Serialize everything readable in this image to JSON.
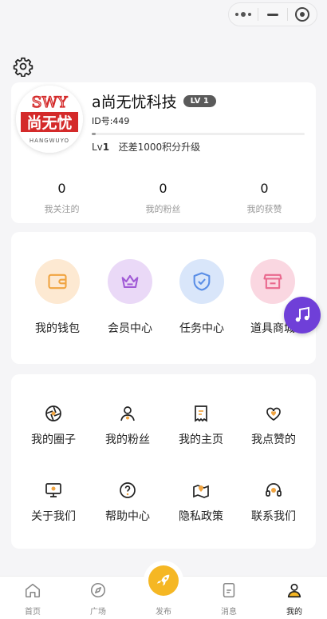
{
  "user": {
    "name": "a尚无忧科技",
    "level_badge": "LV 1",
    "id_text": "ID号:449",
    "level_prefix": "Lv",
    "level_num": "1",
    "level_hint": "还差1000积分升级",
    "progress": 0.02,
    "avatar_logo_text": "SWY",
    "avatar_main_text": "尚无忧",
    "avatar_sub_text": "HANGWUYO"
  },
  "stats": [
    {
      "value": "0",
      "label": "我关注的"
    },
    {
      "value": "0",
      "label": "我的粉丝"
    },
    {
      "value": "0",
      "label": "我的获赞"
    }
  ],
  "features": [
    {
      "label": "我的钱包",
      "icon": "wallet-icon",
      "bg": "#fde9d2",
      "color": "#f0a441"
    },
    {
      "label": "会员中心",
      "icon": "crown-icon",
      "bg": "#ead9f7",
      "color": "#a15bd6"
    },
    {
      "label": "任务中心",
      "icon": "shield-check-icon",
      "bg": "#d9e6fa",
      "color": "#5a8ee6"
    },
    {
      "label": "道具商城",
      "icon": "store-icon",
      "bg": "#fad7e1",
      "color": "#e9698e"
    }
  ],
  "menu": [
    {
      "label": "我的圈子",
      "icon": "aperture-icon"
    },
    {
      "label": "我的粉丝",
      "icon": "person-icon"
    },
    {
      "label": "我的主页",
      "icon": "receipt-icon"
    },
    {
      "label": "我点赞的",
      "icon": "heart-icon"
    },
    {
      "label": "关于我们",
      "icon": "monitor-icon"
    },
    {
      "label": "帮助中心",
      "icon": "question-icon"
    },
    {
      "label": "隐私政策",
      "icon": "map-pin-icon"
    },
    {
      "label": "联系我们",
      "icon": "headset-icon"
    }
  ],
  "tabs": [
    {
      "label": "首页",
      "icon": "home-icon"
    },
    {
      "label": "广场",
      "icon": "compass-icon"
    },
    {
      "label": "发布",
      "icon": "rocket-icon"
    },
    {
      "label": "消息",
      "icon": "message-icon"
    },
    {
      "label": "我的",
      "icon": "user-icon"
    }
  ],
  "colors": {
    "accent": "#f5b724",
    "music_button": "#6f3fd8",
    "icon_accent": "#f0a441"
  }
}
